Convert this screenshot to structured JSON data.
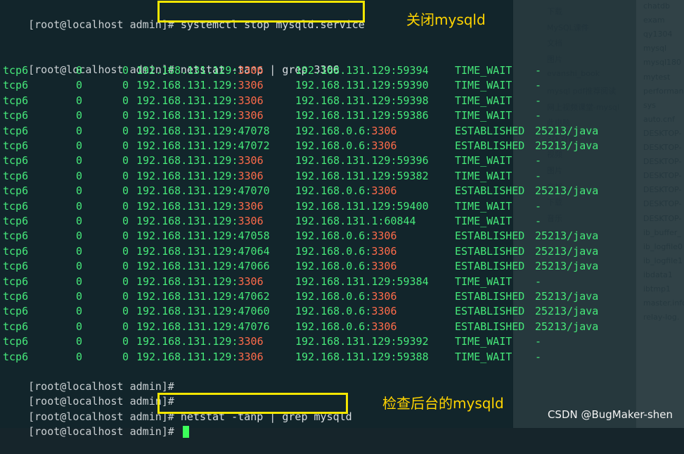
{
  "terminal": {
    "prompt": "[root@localhost admin]# ",
    "cmd_stop": "systemctl stop mysqld.service",
    "cmd_netstat_port": "netstat -tanp | grep 3306",
    "cmd_netstat_name": "netstat -tanp | grep mysqld",
    "highlight_port": "3306",
    "rows": [
      {
        "proto": "tcp6",
        "recvq": "0",
        "sendq": "0",
        "local_ip": "192.168.131.129:",
        "local_port": "3306",
        "foreign_ip": "192.168.131.129:",
        "foreign_port": "59394",
        "state": "TIME_WAIT",
        "pid": "-",
        "red": "local"
      },
      {
        "proto": "tcp6",
        "recvq": "0",
        "sendq": "0",
        "local_ip": "192.168.131.129:",
        "local_port": "3306",
        "foreign_ip": "192.168.131.129:",
        "foreign_port": "59390",
        "state": "TIME_WAIT",
        "pid": "-",
        "red": "local"
      },
      {
        "proto": "tcp6",
        "recvq": "0",
        "sendq": "0",
        "local_ip": "192.168.131.129:",
        "local_port": "3306",
        "foreign_ip": "192.168.131.129:",
        "foreign_port": "59398",
        "state": "TIME_WAIT",
        "pid": "-",
        "red": "local"
      },
      {
        "proto": "tcp6",
        "recvq": "0",
        "sendq": "0",
        "local_ip": "192.168.131.129:",
        "local_port": "3306",
        "foreign_ip": "192.168.131.129:",
        "foreign_port": "59386",
        "state": "TIME_WAIT",
        "pid": "-",
        "red": "local"
      },
      {
        "proto": "tcp6",
        "recvq": "0",
        "sendq": "0",
        "local_ip": "192.168.131.129:",
        "local_port": "47078",
        "foreign_ip": "192.168.0.6:",
        "foreign_port": "3306",
        "state": "ESTABLISHED",
        "pid": "25213/java",
        "red": "foreign"
      },
      {
        "proto": "tcp6",
        "recvq": "0",
        "sendq": "0",
        "local_ip": "192.168.131.129:",
        "local_port": "47072",
        "foreign_ip": "192.168.0.6:",
        "foreign_port": "3306",
        "state": "ESTABLISHED",
        "pid": "25213/java",
        "red": "foreign"
      },
      {
        "proto": "tcp6",
        "recvq": "0",
        "sendq": "0",
        "local_ip": "192.168.131.129:",
        "local_port": "3306",
        "foreign_ip": "192.168.131.129:",
        "foreign_port": "59396",
        "state": "TIME_WAIT",
        "pid": "-",
        "red": "local"
      },
      {
        "proto": "tcp6",
        "recvq": "0",
        "sendq": "0",
        "local_ip": "192.168.131.129:",
        "local_port": "3306",
        "foreign_ip": "192.168.131.129:",
        "foreign_port": "59382",
        "state": "TIME_WAIT",
        "pid": "-",
        "red": "local"
      },
      {
        "proto": "tcp6",
        "recvq": "0",
        "sendq": "0",
        "local_ip": "192.168.131.129:",
        "local_port": "47070",
        "foreign_ip": "192.168.0.6:",
        "foreign_port": "3306",
        "state": "ESTABLISHED",
        "pid": "25213/java",
        "red": "foreign"
      },
      {
        "proto": "tcp6",
        "recvq": "0",
        "sendq": "0",
        "local_ip": "192.168.131.129:",
        "local_port": "3306",
        "foreign_ip": "192.168.131.129:",
        "foreign_port": "59400",
        "state": "TIME_WAIT",
        "pid": "-",
        "red": "local"
      },
      {
        "proto": "tcp6",
        "recvq": "0",
        "sendq": "0",
        "local_ip": "192.168.131.129:",
        "local_port": "3306",
        "foreign_ip": "192.168.131.1:",
        "foreign_port": "60844",
        "state": "TIME_WAIT",
        "pid": "-",
        "red": "local"
      },
      {
        "proto": "tcp6",
        "recvq": "0",
        "sendq": "0",
        "local_ip": "192.168.131.129:",
        "local_port": "47058",
        "foreign_ip": "192.168.0.6:",
        "foreign_port": "3306",
        "state": "ESTABLISHED",
        "pid": "25213/java",
        "red": "foreign"
      },
      {
        "proto": "tcp6",
        "recvq": "0",
        "sendq": "0",
        "local_ip": "192.168.131.129:",
        "local_port": "47064",
        "foreign_ip": "192.168.0.6:",
        "foreign_port": "3306",
        "state": "ESTABLISHED",
        "pid": "25213/java",
        "red": "foreign"
      },
      {
        "proto": "tcp6",
        "recvq": "0",
        "sendq": "0",
        "local_ip": "192.168.131.129:",
        "local_port": "47066",
        "foreign_ip": "192.168.0.6:",
        "foreign_port": "3306",
        "state": "ESTABLISHED",
        "pid": "25213/java",
        "red": "foreign"
      },
      {
        "proto": "tcp6",
        "recvq": "0",
        "sendq": "0",
        "local_ip": "192.168.131.129:",
        "local_port": "3306",
        "foreign_ip": "192.168.131.129:",
        "foreign_port": "59384",
        "state": "TIME_WAIT",
        "pid": "-",
        "red": "local"
      },
      {
        "proto": "tcp6",
        "recvq": "0",
        "sendq": "0",
        "local_ip": "192.168.131.129:",
        "local_port": "47062",
        "foreign_ip": "192.168.0.6:",
        "foreign_port": "3306",
        "state": "ESTABLISHED",
        "pid": "25213/java",
        "red": "foreign"
      },
      {
        "proto": "tcp6",
        "recvq": "0",
        "sendq": "0",
        "local_ip": "192.168.131.129:",
        "local_port": "47060",
        "foreign_ip": "192.168.0.6:",
        "foreign_port": "3306",
        "state": "ESTABLISHED",
        "pid": "25213/java",
        "red": "foreign"
      },
      {
        "proto": "tcp6",
        "recvq": "0",
        "sendq": "0",
        "local_ip": "192.168.131.129:",
        "local_port": "47076",
        "foreign_ip": "192.168.0.6:",
        "foreign_port": "3306",
        "state": "ESTABLISHED",
        "pid": "25213/java",
        "red": "foreign"
      },
      {
        "proto": "tcp6",
        "recvq": "0",
        "sendq": "0",
        "local_ip": "192.168.131.129:",
        "local_port": "3306",
        "foreign_ip": "192.168.131.129:",
        "foreign_port": "59392",
        "state": "TIME_WAIT",
        "pid": "-",
        "red": "local"
      },
      {
        "proto": "tcp6",
        "recvq": "0",
        "sendq": "0",
        "local_ip": "192.168.131.129:",
        "local_port": "3306",
        "foreign_ip": "192.168.131.129:",
        "foreign_port": "59388",
        "state": "TIME_WAIT",
        "pid": "-",
        "red": "local"
      }
    ]
  },
  "annotations": {
    "stop_note": "关闭mysqld",
    "check_note": "检查后台的mysqld"
  },
  "background": {
    "explorer_items": [
      "chatdb",
      "exam",
      "qy1304",
      "mysql",
      "mysql180",
      "mytest",
      "performan",
      "sys",
      "auto.cnf",
      "DESKTOP-",
      "DESKTOP-",
      "DESKTOP-",
      "DESKTOP-",
      "DESKTOP-",
      "DESKTOP-",
      "DESKTOP-",
      "ib_buffer_",
      "ib_logfile0",
      "ib_logfile1",
      "ibdata1",
      "ibtmp1",
      "master.info",
      "relay-log."
    ],
    "quick_items": [
      "下载",
      "MySQL课件",
      "文档",
      "图片",
      "evanshi_book",
      "mysql pdf推荐阅读",
      "网上视频课堂-mysql",
      "此电脑",
      "3D 对象",
      "视频",
      "图片",
      "文档",
      "下载",
      "音乐",
      "桌面"
    ]
  },
  "watermark": "CSDN @BugMaker-shen",
  "colors": {
    "prompt_text": "#c9cfd2",
    "output_text": "#46e87a",
    "port_highlight": "#ff6b4a",
    "box_border": "#f4e600",
    "annotation": "#ffd400"
  }
}
